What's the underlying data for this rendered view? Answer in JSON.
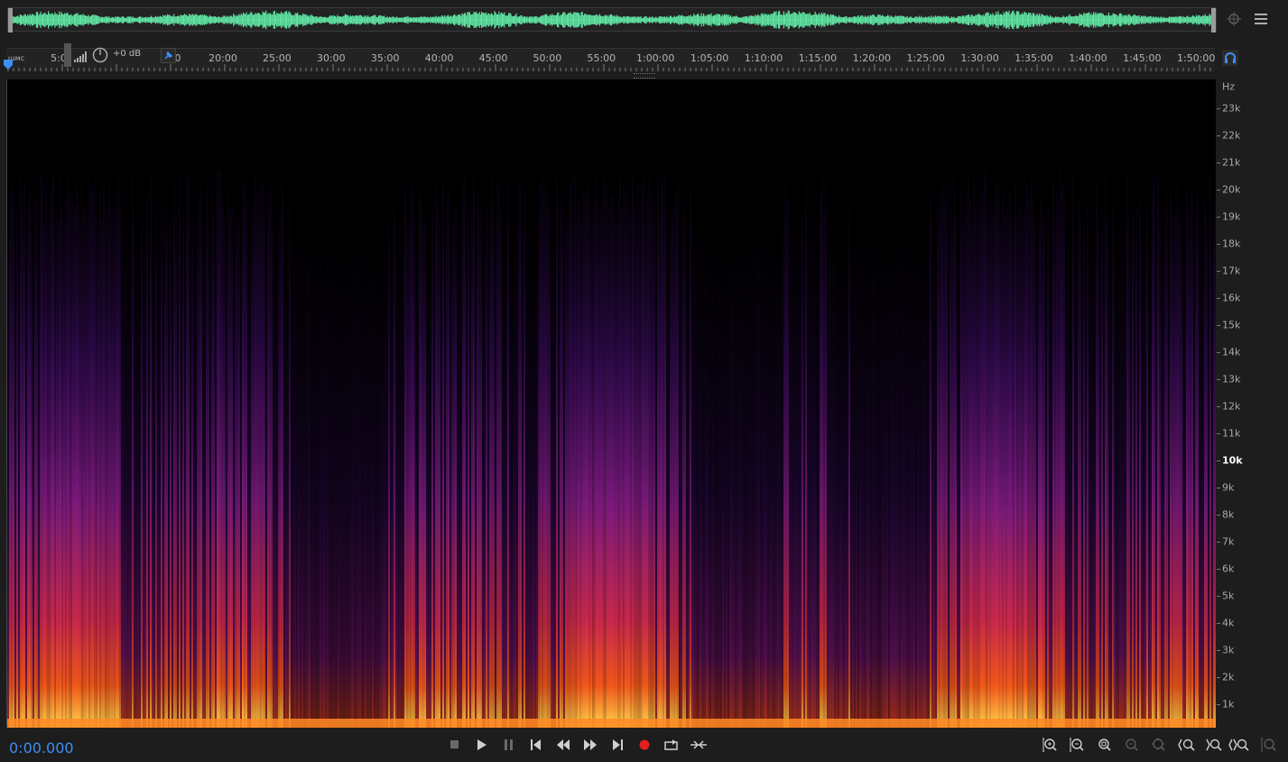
{
  "ruler": {
    "start_label": "ɯмс",
    "partial_label": "5:0",
    "volume": "+0 dB",
    "ticks": [
      "0",
      "20:00",
      "25:00",
      "30:00",
      "35:00",
      "40:00",
      "45:00",
      "50:00",
      "55:00",
      "1:00:00",
      "1:05:00",
      "1:10:00",
      "1:15:00",
      "1:20:00",
      "1:25:00",
      "1:30:00",
      "1:35:00",
      "1:40:00",
      "1:45:00",
      "1:50:00"
    ]
  },
  "frequency_axis": {
    "unit": "Hz",
    "labels": [
      "23k",
      "22k",
      "21k",
      "20k",
      "19k",
      "18k",
      "17k",
      "16k",
      "15k",
      "14k",
      "13k",
      "12k",
      "11k",
      "10k",
      "9k",
      "8k",
      "7k",
      "6k",
      "5k",
      "4k",
      "3k",
      "2k",
      "1k"
    ],
    "emphasized": "10k"
  },
  "transport": {
    "timecode": "0:00.000"
  },
  "colors": {
    "accent": "#3d8ff5",
    "waveform": "#5fe0a0",
    "record": "#e02020"
  },
  "icons": {
    "top_right": [
      "target-icon",
      "menu-icon"
    ],
    "transport": [
      "stop-icon",
      "play-icon",
      "pause-icon",
      "go-to-start-icon",
      "rewind-icon",
      "fast-forward-icon",
      "go-to-end-icon",
      "record-icon",
      "loop-icon",
      "skip-selection-icon"
    ],
    "zoom": [
      "zoom-in-amplitude-icon",
      "zoom-out-amplitude-icon",
      "zoom-full-icon",
      "zoom-out-full-icon",
      "zoom-selection-icon",
      "zoom-in-left-icon",
      "zoom-in-right-icon",
      "zoom-in-both-icon",
      "zoom-reset-icon"
    ]
  }
}
